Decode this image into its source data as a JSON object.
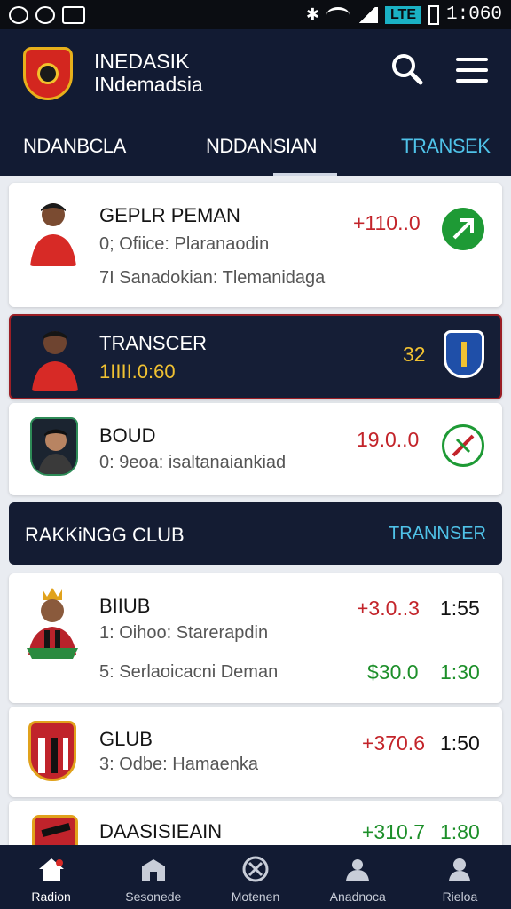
{
  "status_bar": {
    "time": "1:060",
    "network": "LTE"
  },
  "header": {
    "title": "INEDASIK",
    "subtitle": "INdemadsia",
    "tabs": [
      "NDANBCLA",
      "NDDANSIAN",
      "TRANSEK"
    ]
  },
  "cards": [
    {
      "name": "GEPLR PEMAN",
      "line1": "0; Ofiice: Plaranaodin",
      "line2": "7I Sanadokian: Tlemanidaga",
      "price": "+110..0"
    },
    {
      "name": "TRANSCER",
      "line1": "1IIII.0:60",
      "price": "32"
    },
    {
      "name": "BOUD",
      "line1": "0: 9eoa: isaltanaiankiad",
      "price": "19.0..0"
    }
  ],
  "section": {
    "title": "RAKKiNGG CLUB",
    "link": "TRANNSER"
  },
  "club_rows": [
    {
      "name": "BIIUB",
      "line1": "1: Oihoo: Starerapdin",
      "line2": "5: Serlaoicacni Deman",
      "price1": "+3.0..3",
      "time1": "1:55",
      "price2": "$30.0",
      "time2": "1:30"
    },
    {
      "name": "GLUB",
      "line1": "3: Odbe: Hamaenka",
      "price1": "+370.6",
      "time1": "1:50"
    },
    {
      "name": "DAASISIEAIN",
      "price1": "+310.7",
      "time1": "1:80"
    }
  ],
  "bottom_nav": [
    "Radion",
    "Sesonede",
    "Motenen",
    "Anadnoca",
    "Rieloa"
  ],
  "colors": {
    "primary": "#121b33",
    "accent": "#4fc2e8",
    "red": "#c3242a",
    "green": "#1d8f2a",
    "gold": "#f1c232"
  }
}
